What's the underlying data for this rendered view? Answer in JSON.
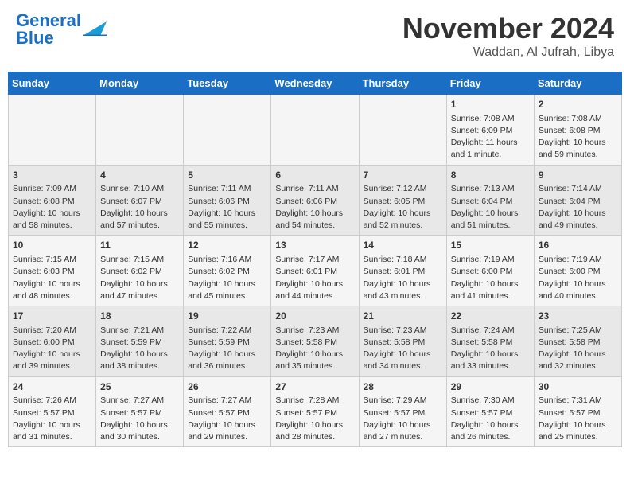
{
  "header": {
    "logo_text1": "General",
    "logo_text2": "Blue",
    "month": "November 2024",
    "location": "Waddan, Al Jufrah, Libya"
  },
  "days_of_week": [
    "Sunday",
    "Monday",
    "Tuesday",
    "Wednesday",
    "Thursday",
    "Friday",
    "Saturday"
  ],
  "weeks": [
    [
      {
        "day": "",
        "text": ""
      },
      {
        "day": "",
        "text": ""
      },
      {
        "day": "",
        "text": ""
      },
      {
        "day": "",
        "text": ""
      },
      {
        "day": "",
        "text": ""
      },
      {
        "day": "1",
        "text": "Sunrise: 7:08 AM\nSunset: 6:09 PM\nDaylight: 11 hours\nand 1 minute."
      },
      {
        "day": "2",
        "text": "Sunrise: 7:08 AM\nSunset: 6:08 PM\nDaylight: 10 hours\nand 59 minutes."
      }
    ],
    [
      {
        "day": "3",
        "text": "Sunrise: 7:09 AM\nSunset: 6:08 PM\nDaylight: 10 hours\nand 58 minutes."
      },
      {
        "day": "4",
        "text": "Sunrise: 7:10 AM\nSunset: 6:07 PM\nDaylight: 10 hours\nand 57 minutes."
      },
      {
        "day": "5",
        "text": "Sunrise: 7:11 AM\nSunset: 6:06 PM\nDaylight: 10 hours\nand 55 minutes."
      },
      {
        "day": "6",
        "text": "Sunrise: 7:11 AM\nSunset: 6:06 PM\nDaylight: 10 hours\nand 54 minutes."
      },
      {
        "day": "7",
        "text": "Sunrise: 7:12 AM\nSunset: 6:05 PM\nDaylight: 10 hours\nand 52 minutes."
      },
      {
        "day": "8",
        "text": "Sunrise: 7:13 AM\nSunset: 6:04 PM\nDaylight: 10 hours\nand 51 minutes."
      },
      {
        "day": "9",
        "text": "Sunrise: 7:14 AM\nSunset: 6:04 PM\nDaylight: 10 hours\nand 49 minutes."
      }
    ],
    [
      {
        "day": "10",
        "text": "Sunrise: 7:15 AM\nSunset: 6:03 PM\nDaylight: 10 hours\nand 48 minutes."
      },
      {
        "day": "11",
        "text": "Sunrise: 7:15 AM\nSunset: 6:02 PM\nDaylight: 10 hours\nand 47 minutes."
      },
      {
        "day": "12",
        "text": "Sunrise: 7:16 AM\nSunset: 6:02 PM\nDaylight: 10 hours\nand 45 minutes."
      },
      {
        "day": "13",
        "text": "Sunrise: 7:17 AM\nSunset: 6:01 PM\nDaylight: 10 hours\nand 44 minutes."
      },
      {
        "day": "14",
        "text": "Sunrise: 7:18 AM\nSunset: 6:01 PM\nDaylight: 10 hours\nand 43 minutes."
      },
      {
        "day": "15",
        "text": "Sunrise: 7:19 AM\nSunset: 6:00 PM\nDaylight: 10 hours\nand 41 minutes."
      },
      {
        "day": "16",
        "text": "Sunrise: 7:19 AM\nSunset: 6:00 PM\nDaylight: 10 hours\nand 40 minutes."
      }
    ],
    [
      {
        "day": "17",
        "text": "Sunrise: 7:20 AM\nSunset: 6:00 PM\nDaylight: 10 hours\nand 39 minutes."
      },
      {
        "day": "18",
        "text": "Sunrise: 7:21 AM\nSunset: 5:59 PM\nDaylight: 10 hours\nand 38 minutes."
      },
      {
        "day": "19",
        "text": "Sunrise: 7:22 AM\nSunset: 5:59 PM\nDaylight: 10 hours\nand 36 minutes."
      },
      {
        "day": "20",
        "text": "Sunrise: 7:23 AM\nSunset: 5:58 PM\nDaylight: 10 hours\nand 35 minutes."
      },
      {
        "day": "21",
        "text": "Sunrise: 7:23 AM\nSunset: 5:58 PM\nDaylight: 10 hours\nand 34 minutes."
      },
      {
        "day": "22",
        "text": "Sunrise: 7:24 AM\nSunset: 5:58 PM\nDaylight: 10 hours\nand 33 minutes."
      },
      {
        "day": "23",
        "text": "Sunrise: 7:25 AM\nSunset: 5:58 PM\nDaylight: 10 hours\nand 32 minutes."
      }
    ],
    [
      {
        "day": "24",
        "text": "Sunrise: 7:26 AM\nSunset: 5:57 PM\nDaylight: 10 hours\nand 31 minutes."
      },
      {
        "day": "25",
        "text": "Sunrise: 7:27 AM\nSunset: 5:57 PM\nDaylight: 10 hours\nand 30 minutes."
      },
      {
        "day": "26",
        "text": "Sunrise: 7:27 AM\nSunset: 5:57 PM\nDaylight: 10 hours\nand 29 minutes."
      },
      {
        "day": "27",
        "text": "Sunrise: 7:28 AM\nSunset: 5:57 PM\nDaylight: 10 hours\nand 28 minutes."
      },
      {
        "day": "28",
        "text": "Sunrise: 7:29 AM\nSunset: 5:57 PM\nDaylight: 10 hours\nand 27 minutes."
      },
      {
        "day": "29",
        "text": "Sunrise: 7:30 AM\nSunset: 5:57 PM\nDaylight: 10 hours\nand 26 minutes."
      },
      {
        "day": "30",
        "text": "Sunrise: 7:31 AM\nSunset: 5:57 PM\nDaylight: 10 hours\nand 25 minutes."
      }
    ]
  ]
}
